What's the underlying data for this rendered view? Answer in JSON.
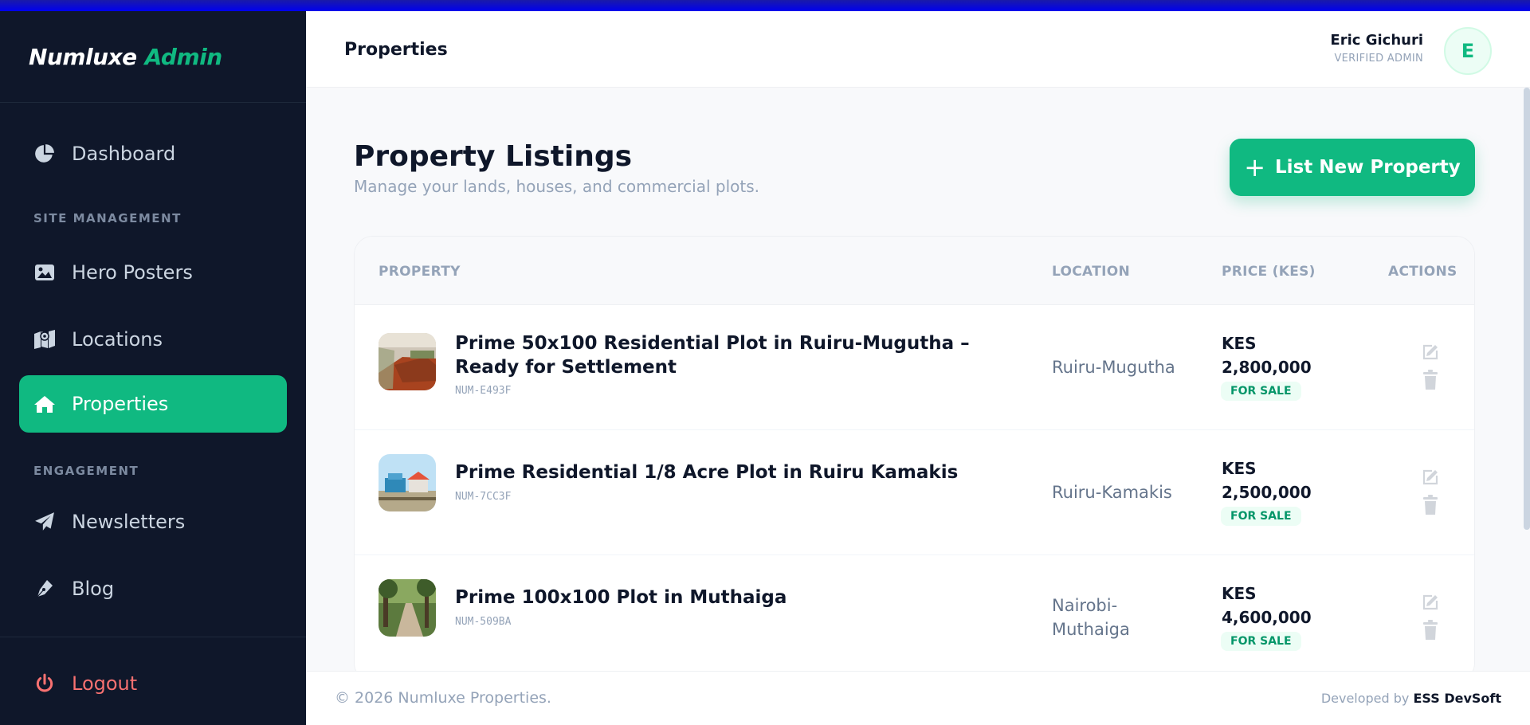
{
  "brand": {
    "part1": "Numluxe",
    "part2": "Admin"
  },
  "sidebar": {
    "items": [
      {
        "label": "Dashboard",
        "icon": "pie-chart-icon"
      },
      {
        "label": "Hero Posters",
        "icon": "image-icon"
      },
      {
        "label": "Locations",
        "icon": "map-icon"
      },
      {
        "label": "Properties",
        "icon": "home-icon",
        "active": true
      },
      {
        "label": "Newsletters",
        "icon": "paper-plane-icon"
      },
      {
        "label": "Blog",
        "icon": "pen-nib-icon"
      }
    ],
    "sections": {
      "site": "SITE MANAGEMENT",
      "engagement": "ENGAGEMENT"
    },
    "logout": {
      "label": "Logout",
      "icon": "power-icon"
    }
  },
  "header": {
    "title": "Properties",
    "user": {
      "name": "Eric Gichuri",
      "role": "VERIFIED ADMIN",
      "initial": "E"
    }
  },
  "main": {
    "title": "Property Listings",
    "subtitle": "Manage your lands, houses, and commercial plots.",
    "new_button": {
      "plus": "+",
      "label": "List New Property"
    },
    "table": {
      "headers": {
        "property": "PROPERTY",
        "location": "LOCATION",
        "price": "PRICE (KES)",
        "actions": "ACTIONS"
      },
      "rows": [
        {
          "title": "Prime 50x100 Residential Plot in Ruiru-Mugutha – Ready for Settlement",
          "code": "NUM-E493F",
          "location": "Ruiru-Mugutha",
          "currency": "KES",
          "amount": "2,800,000",
          "status": "FOR SALE"
        },
        {
          "title": "Prime Residential 1/8 Acre Plot in Ruiru Kamakis",
          "code": "NUM-7CC3F",
          "location": "Ruiru-Kamakis",
          "currency": "KES",
          "amount": "2,500,000",
          "status": "FOR SALE"
        },
        {
          "title": "Prime 100x100 Plot in Muthaiga",
          "code": "NUM-509BA",
          "location": "Nairobi-Muthaiga",
          "currency": "KES",
          "amount": "4,600,000",
          "status": "FOR SALE"
        }
      ]
    }
  },
  "footer": {
    "copyright": "© 2026 Numluxe Properties.",
    "developed_by": "Developed by",
    "developer": "ESS DevSoft"
  },
  "colors": {
    "accent": "#10b981",
    "sidebar_bg": "#0f172a",
    "logout": "#f87171"
  }
}
